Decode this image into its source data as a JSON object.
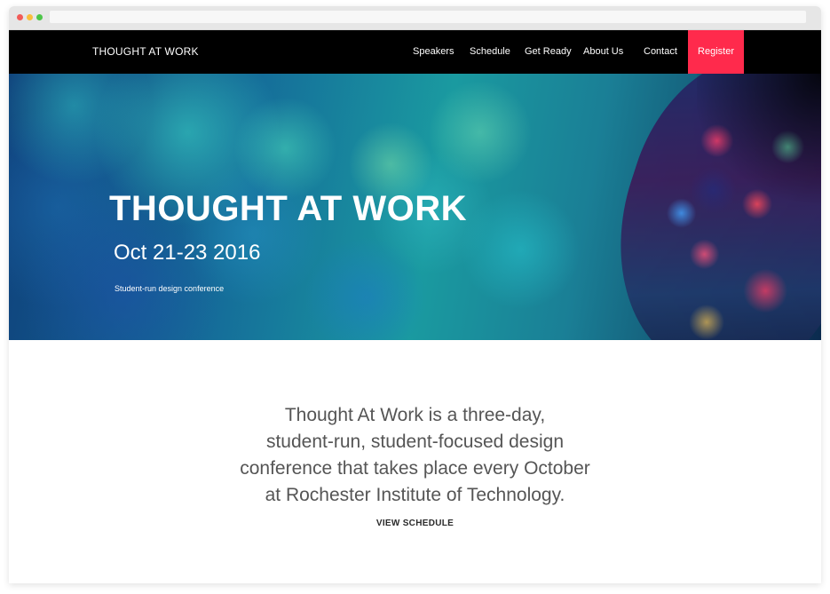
{
  "nav": {
    "brand": "THOUGHT AT WORK",
    "links": [
      "Speakers",
      "Schedule",
      "Get Ready",
      "About Us",
      "Contact"
    ],
    "register": "Register",
    "register_color": "#ff2a4c"
  },
  "hero": {
    "title": "THOUGHT AT WORK",
    "date": "Oct 21-23 2016",
    "tagline": "Student-run design conference"
  },
  "intro": {
    "lines": [
      "Thought At Work is a three-day,",
      "student-run, student-focused design",
      "conference that takes place every October",
      "at Rochester Institute of Technology."
    ],
    "cta": "VIEW SCHEDULE"
  }
}
